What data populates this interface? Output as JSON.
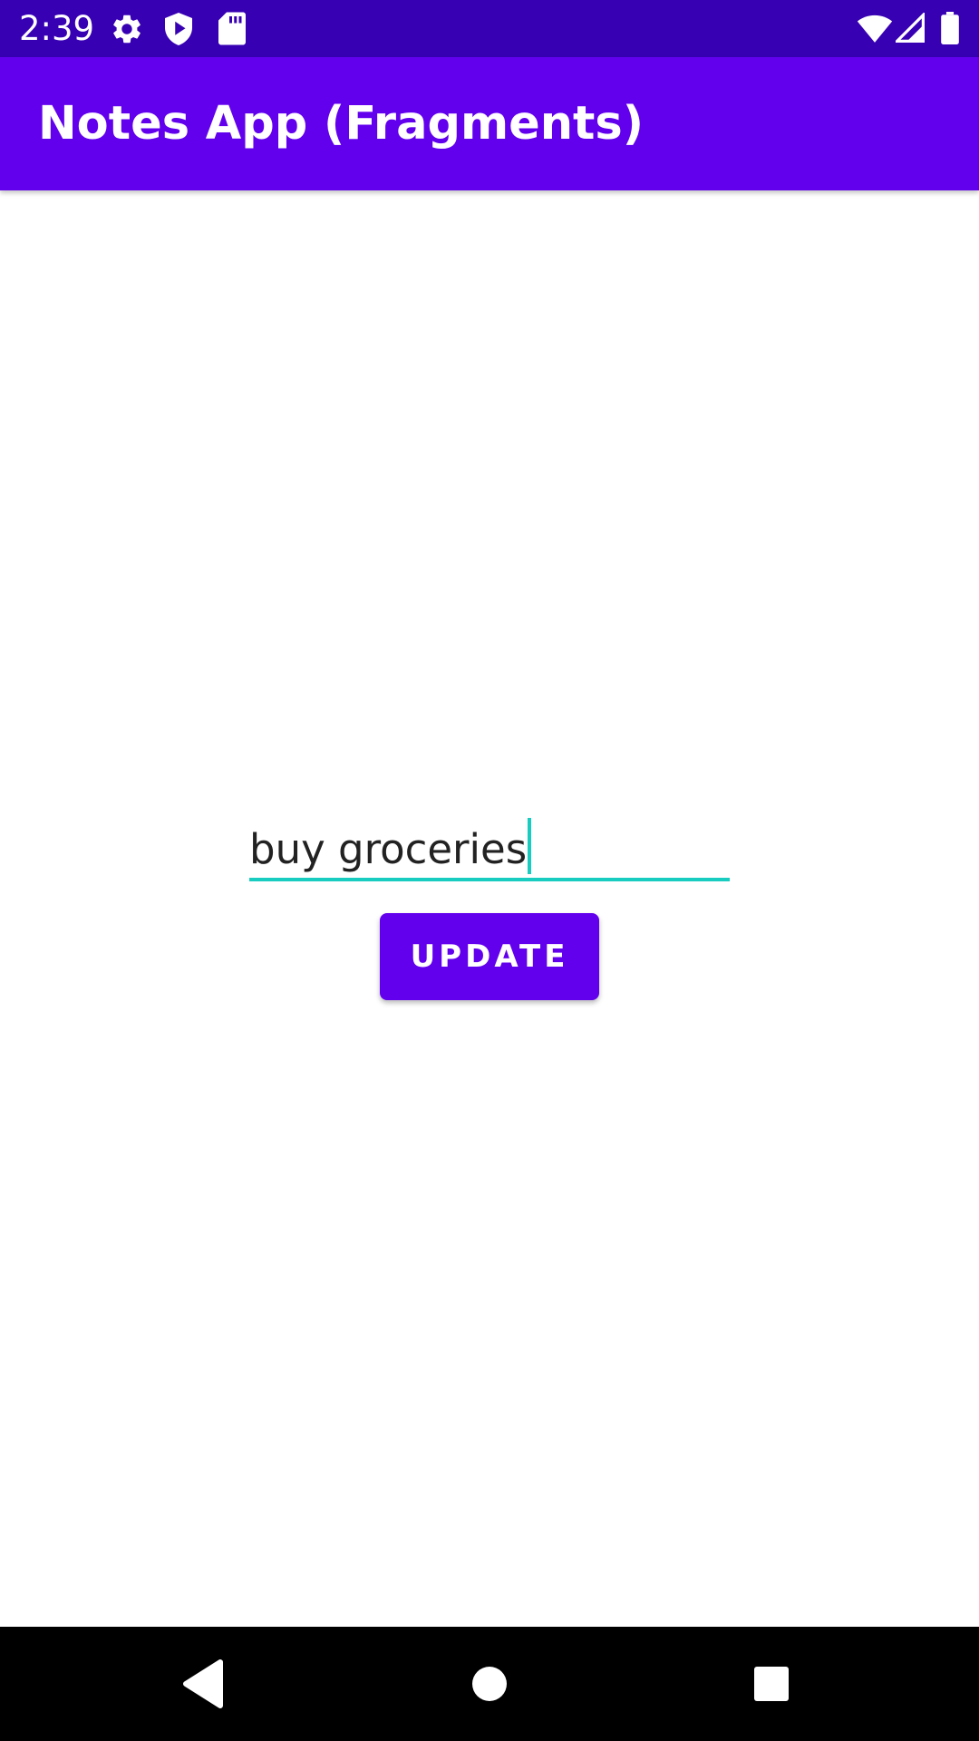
{
  "status_bar": {
    "time": "2:39",
    "left_icons": [
      "gear-icon",
      "play-shield-icon",
      "sd-card-icon"
    ],
    "right_icons": [
      "wifi-icon",
      "signal-icon",
      "battery-icon"
    ],
    "background_color": "#3700b3"
  },
  "app_bar": {
    "title": "Notes App (Fragments)",
    "background_color": "#6200ee"
  },
  "editor": {
    "note_value": "buy groceries",
    "underline_color": "#18cdc0",
    "update_label": "UPDATE"
  },
  "nav_bar": {
    "buttons": [
      "back-icon",
      "home-icon",
      "recents-icon"
    ]
  }
}
